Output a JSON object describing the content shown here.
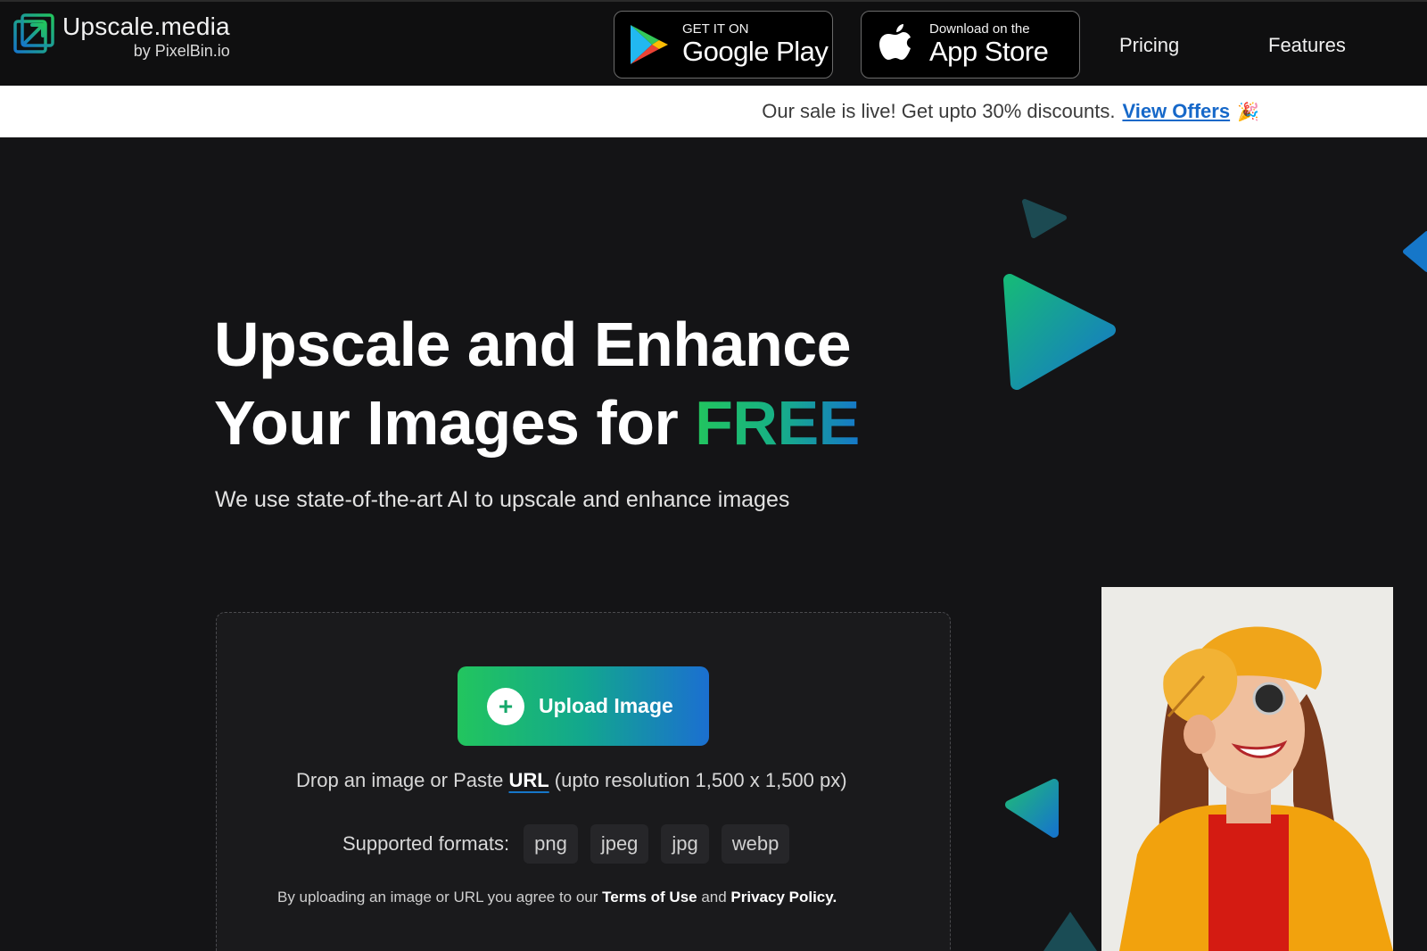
{
  "header": {
    "logo": {
      "name": "Upscale.media",
      "byline": "by PixelBin.io"
    },
    "google_play": {
      "small": "GET IT ON",
      "big": "Google Play"
    },
    "app_store": {
      "small": "Download on the",
      "big": "App Store"
    },
    "nav": {
      "pricing": "Pricing",
      "features": "Features"
    }
  },
  "promo": {
    "text": "Our sale is live! Get upto 30% discounts.",
    "link": "View Offers",
    "emoji": "🎉"
  },
  "hero": {
    "title_line1": "Upscale and Enhance",
    "title_line2_prefix": "Your Images for ",
    "title_highlight": "FREE",
    "subtitle": "We use state-of-the-art AI to upscale and enhance images"
  },
  "upload": {
    "button_label": "Upload Image",
    "drop_prefix": "Drop an image or Paste ",
    "drop_url": "URL",
    "drop_suffix": " (upto resolution 1,500 x 1,500 px)",
    "formats_label": "Supported formats:",
    "formats": [
      "png",
      "jpeg",
      "jpg",
      "webp"
    ],
    "terms_prefix": "By uploading an image or URL you agree to our ",
    "terms_link": "Terms of Use",
    "terms_and": " and ",
    "privacy_link": "Privacy Policy."
  },
  "colors": {
    "brand_green": "#22c55e",
    "brand_blue": "#1677c9",
    "link_blue": "#1668c9",
    "background": "#141416"
  },
  "icons": [
    "upscale-logo-icon",
    "google-play-icon",
    "apple-icon",
    "plus-icon",
    "triangle-decoration"
  ]
}
